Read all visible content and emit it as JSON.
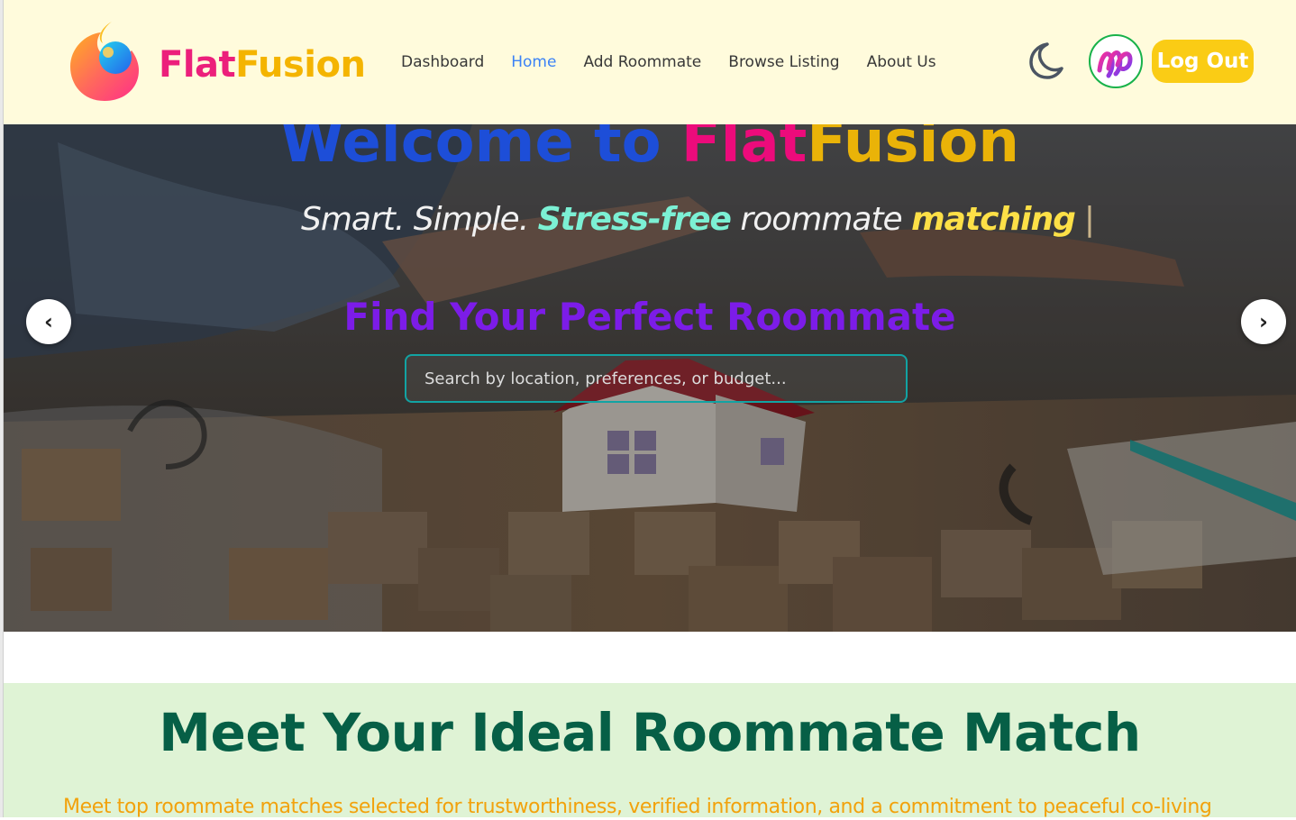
{
  "brand": {
    "part1": "Flat",
    "part2": "Fusion"
  },
  "nav": {
    "links": [
      {
        "label": "Dashboard",
        "active": false
      },
      {
        "label": "Home",
        "active": true
      },
      {
        "label": "Add Roommate",
        "active": false
      },
      {
        "label": "Browse Listing",
        "active": false
      },
      {
        "label": "About Us",
        "active": false
      }
    ],
    "theme_toggle_icon": "moon-icon",
    "logout_label": "Log Out"
  },
  "hero": {
    "title_part1": "Welcome to ",
    "title_part2": "Flat",
    "title_part3": "Fusion",
    "tagline_part1": "Smart. Simple. ",
    "tagline_part2": "Stress-free",
    "tagline_part3": " roommate ",
    "tagline_part4": "matching",
    "tagline_cursor": "|",
    "find_heading": "Find Your Perfect Roommate",
    "search_placeholder": "Search by location, preferences, or budget...",
    "prev_arrow": "‹",
    "next_arrow": "›"
  },
  "section": {
    "title": "Meet Your Ideal Roommate Match",
    "description": "Meet top roommate matches selected for trustworthiness, verified information, and a commitment to peaceful co-living"
  },
  "colors": {
    "navbar_bg": "#fffbdc",
    "brand_pink": "#ec1f7b",
    "brand_yellow": "#f4b400",
    "active_link": "#3b82f6",
    "logout_bg": "#facc15",
    "section_bg": "#dff3d5",
    "section_title": "#065f46",
    "find_heading": "#7c1ce8"
  }
}
